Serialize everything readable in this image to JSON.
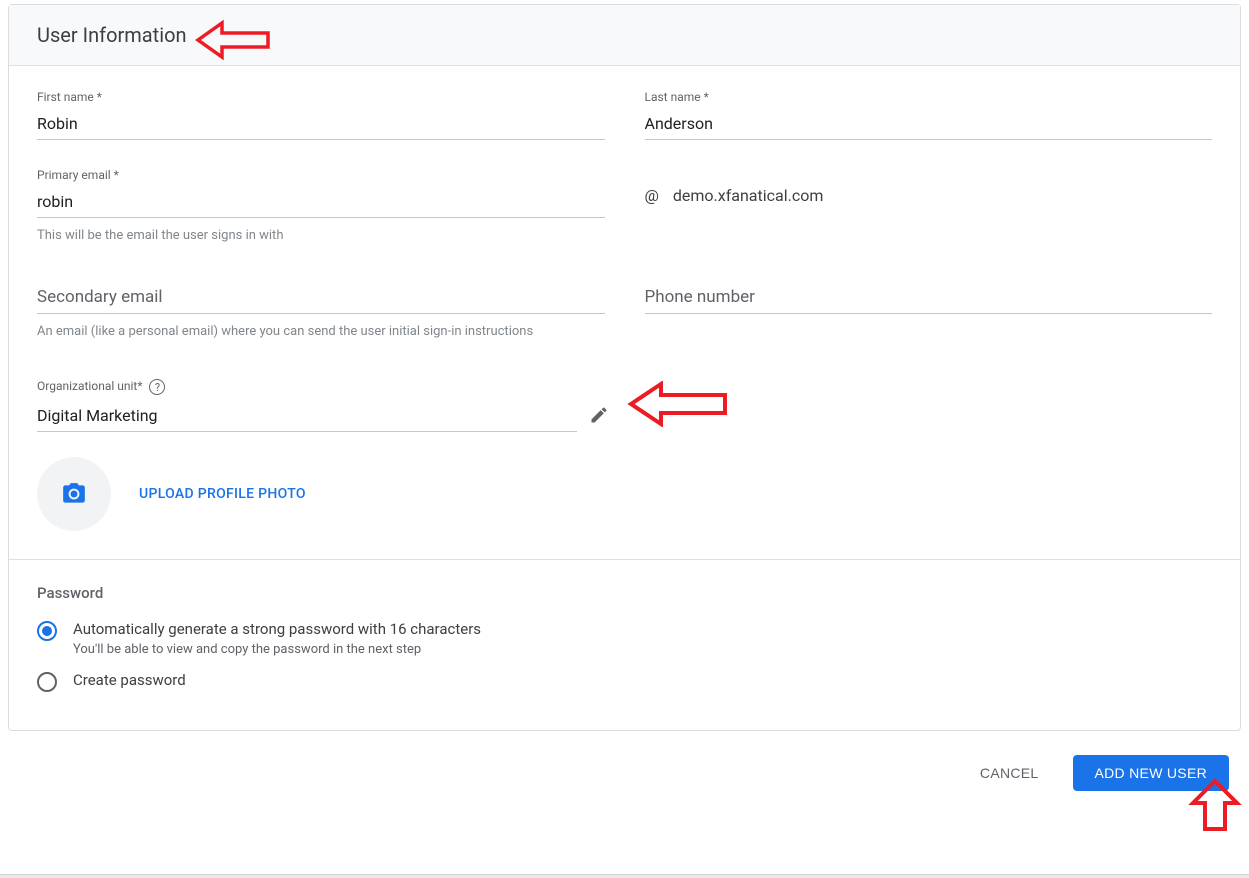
{
  "header": {
    "title": "User Information"
  },
  "fields": {
    "first_name_label": "First name *",
    "first_name_value": "Robin",
    "last_name_label": "Last name *",
    "last_name_value": "Anderson",
    "primary_email_label": "Primary email *",
    "primary_email_value": "robin",
    "primary_email_helper": "This will be the email the user signs in with",
    "domain_at": "@",
    "domain_value": "demo.xfanatical.com",
    "secondary_email_placeholder": "Secondary email",
    "secondary_email_helper": "An email (like a personal email) where you can send the user initial sign-in instructions",
    "phone_placeholder": "Phone number",
    "org_unit_label": "Organizational unit*",
    "org_unit_value": "Digital Marketing",
    "upload_photo_label": "UPLOAD PROFILE PHOTO"
  },
  "password": {
    "section_title": "Password",
    "option_auto_label": "Automatically generate a strong password with 16 characters",
    "option_auto_sub": "You'll be able to view and copy the password in the next step",
    "option_create_label": "Create password"
  },
  "actions": {
    "cancel": "CANCEL",
    "add_user": "ADD NEW USER"
  }
}
